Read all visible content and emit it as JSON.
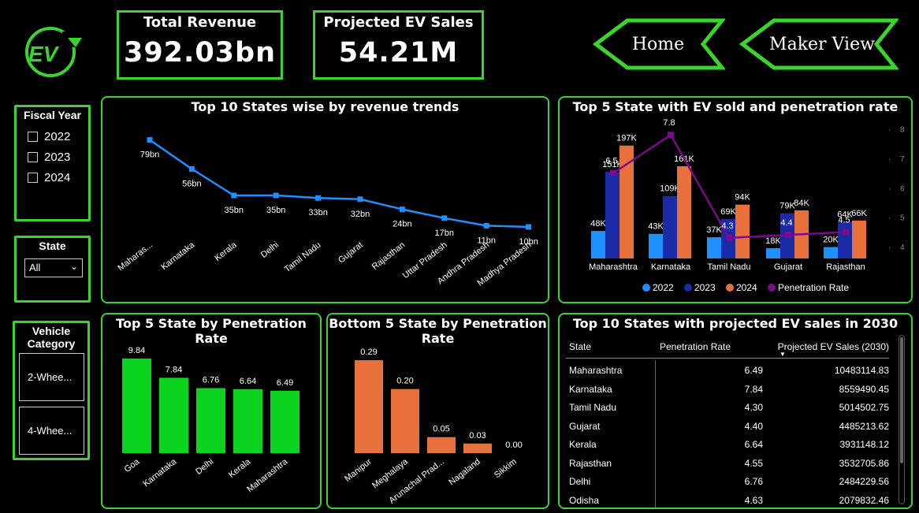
{
  "logo": {
    "text": "EV"
  },
  "kpis": [
    {
      "title": "Total Revenue",
      "value": "392.03bn"
    },
    {
      "title": "Projected EV Sales",
      "value": "54.21M"
    }
  ],
  "nav": {
    "home_label": "Home",
    "maker_label": "Maker View"
  },
  "slicers": {
    "fiscal_year": {
      "title": "Fiscal Year",
      "options": [
        "2022",
        "2023",
        "2024"
      ]
    },
    "state": {
      "title": "State",
      "selected": "All"
    },
    "vehicle_category": {
      "title": "Vehicle Category",
      "options": [
        "2-Whee...",
        "4-Whee..."
      ]
    }
  },
  "colors": {
    "accent": "#39d42c",
    "line_blue": "#1e90ff",
    "bar_green": "#0bd41f",
    "bar_orange": "#e8703a",
    "y2022": "#1e90ff",
    "y2023": "#1b2ba8",
    "y2024": "#e8703a",
    "penetration": "#7b0a8c"
  },
  "chart_data": [
    {
      "type": "line",
      "title": "Top 10 States wise by revenue trends",
      "categories": [
        "Maharas...",
        "Karnataka",
        "Kerala",
        "Delhi",
        "Tamil Nadu",
        "Gujarat",
        "Rajasthan",
        "Uttar Pradesh",
        "Andhra Pradesh",
        "Madhya Pradesh"
      ],
      "values": [
        79,
        56,
        35,
        35,
        33,
        32,
        24,
        17,
        11,
        10
      ],
      "labels": [
        "79bn",
        "56bn",
        "35bn",
        "35bn",
        "33bn",
        "32bn",
        "24bn",
        "17bn",
        "11bn",
        "10bn"
      ],
      "ylim": [
        0,
        90
      ]
    },
    {
      "type": "bar",
      "title": "Top 5 State with EV sold and penetration rate",
      "categories": [
        "Maharashtra",
        "Karnataka",
        "Tamil Nadu",
        "Gujarat",
        "Rajasthan"
      ],
      "series": [
        {
          "name": "2022",
          "values": [
            48,
            43,
            37,
            18,
            20
          ],
          "labels": [
            "48K",
            "43K",
            "37K",
            "18K",
            "20K"
          ]
        },
        {
          "name": "2023",
          "values": [
            151,
            109,
            69,
            79,
            64
          ],
          "labels": [
            "151K",
            "109K",
            "69K",
            "79K",
            "64K"
          ]
        },
        {
          "name": "2024",
          "values": [
            197,
            161,
            94,
            84,
            66
          ],
          "labels": [
            "197K",
            "161K",
            "94K",
            "84K",
            "66K"
          ]
        },
        {
          "name": "Penetration Rate",
          "type": "line",
          "values": [
            6.5,
            7.8,
            4.3,
            4.4,
            4.5
          ],
          "labels": [
            "6.5",
            "7.8",
            "4.3",
            "4.4",
            "4.5"
          ]
        }
      ],
      "ylim": [
        0,
        220
      ],
      "y2lim": [
        3.6,
        8.1
      ],
      "y2ticks": [
        "8",
        "7",
        "6",
        "5",
        "4"
      ],
      "legend": "bottom"
    },
    {
      "type": "bar",
      "title": "Top 5 State by Penetration Rate",
      "categories": [
        "Goa",
        "Karnataka",
        "Delhi",
        "Kerala",
        "Maharashtra"
      ],
      "values": [
        9.84,
        7.84,
        6.76,
        6.64,
        6.49
      ],
      "labels": [
        "9.84",
        "7.84",
        "6.76",
        "6.64",
        "6.49"
      ],
      "ylim": [
        0,
        10
      ]
    },
    {
      "type": "bar",
      "title": "Bottom 5 State by Penetration Rate",
      "categories": [
        "Manipur",
        "Meghalaya",
        "Arunachal Prad...",
        "Nagaland",
        "Sikkim"
      ],
      "values": [
        0.29,
        0.2,
        0.05,
        0.03,
        0.0
      ],
      "labels": [
        "0.29",
        "0.20",
        "0.05",
        "0.03",
        "0.00"
      ],
      "ylim": [
        0,
        0.3
      ]
    },
    {
      "type": "table",
      "title": "Top 10 States with projected EV sales in 2030",
      "columns": [
        "State",
        "Penetration Rate",
        "Projected EV Sales (2030)"
      ],
      "rows": [
        [
          "Maharashtra",
          "6.49",
          "10483114.83"
        ],
        [
          "Karnataka",
          "7.84",
          "8559490.45"
        ],
        [
          "Tamil Nadu",
          "4.30",
          "5014502.75"
        ],
        [
          "Gujarat",
          "4.40",
          "4485213.62"
        ],
        [
          "Kerala",
          "6.64",
          "3931148.12"
        ],
        [
          "Rajasthan",
          "4.55",
          "3532705.86"
        ],
        [
          "Delhi",
          "6.76",
          "2484229.56"
        ],
        [
          "Odisha",
          "4.63",
          "2079832.46"
        ]
      ]
    }
  ]
}
